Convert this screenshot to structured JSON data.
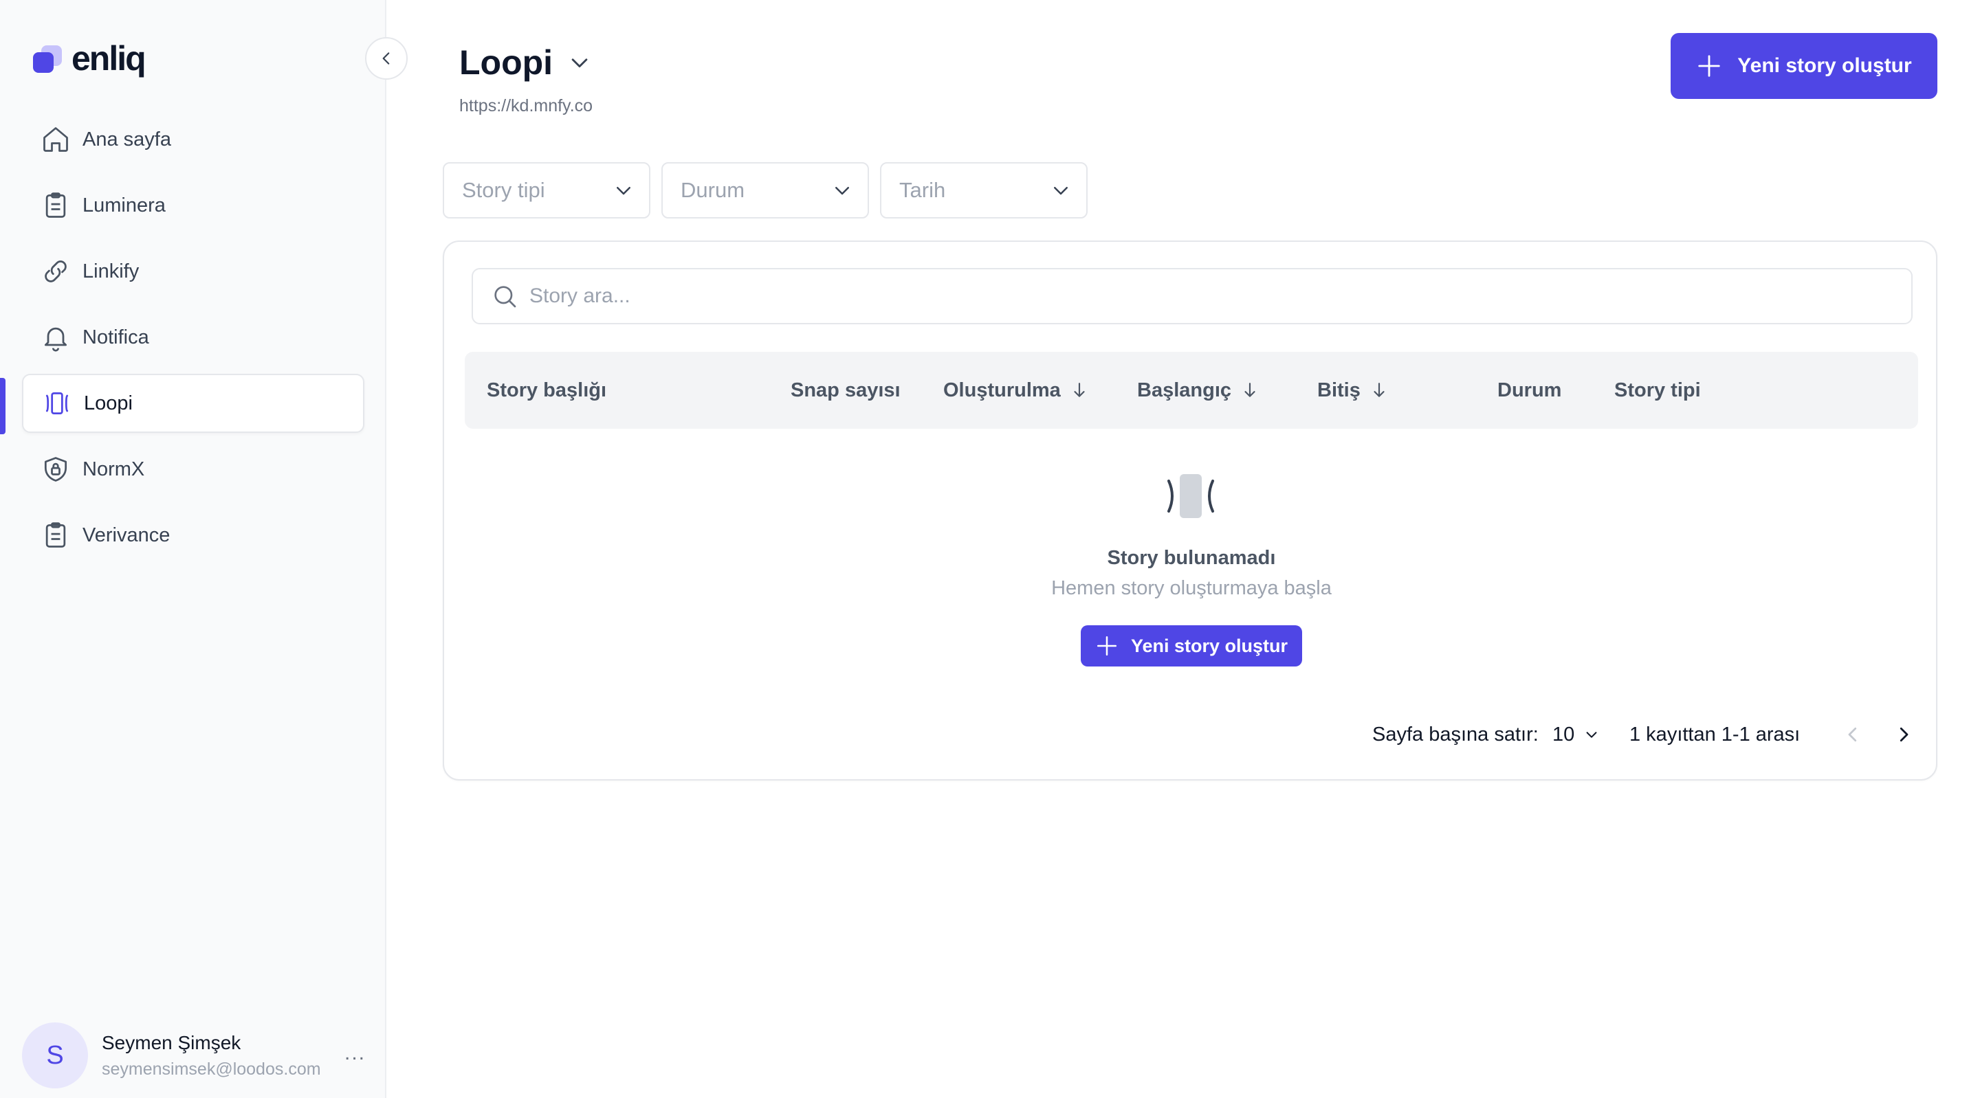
{
  "app": {
    "logo_text": "enliq"
  },
  "sidebar": {
    "items": [
      {
        "label": "Ana sayfa",
        "icon": "home-icon"
      },
      {
        "label": "Luminera",
        "icon": "clipboard-icon"
      },
      {
        "label": "Linkify",
        "icon": "link-icon"
      },
      {
        "label": "Notifica",
        "icon": "bell-icon"
      },
      {
        "label": "Loopi",
        "icon": "stories-icon",
        "active": true
      },
      {
        "label": "NormX",
        "icon": "shield-lock-icon"
      },
      {
        "label": "Verivance",
        "icon": "clipboard-icon"
      }
    ],
    "user": {
      "initial": "S",
      "name": "Seymen Şimşek",
      "email": "seymensimsek@loodos.com",
      "more": "..."
    }
  },
  "header": {
    "title": "Loopi",
    "url": "https://kd.mnfy.co",
    "primary_button": "Yeni story oluştur"
  },
  "filters": [
    {
      "placeholder": "Story tipi"
    },
    {
      "placeholder": "Durum"
    },
    {
      "placeholder": "Tarih"
    }
  ],
  "search": {
    "placeholder": "Story ara..."
  },
  "table": {
    "columns": [
      {
        "label": "Story başlığı",
        "sortable": false
      },
      {
        "label": "Snap sayısı",
        "sortable": false
      },
      {
        "label": "Oluşturulma",
        "sortable": true
      },
      {
        "label": "Başlangıç",
        "sortable": true
      },
      {
        "label": "Bitiş",
        "sortable": true
      },
      {
        "label": "Durum",
        "sortable": false
      },
      {
        "label": "Story tipi",
        "sortable": false
      }
    ]
  },
  "empty_state": {
    "title": "Story bulunamadı",
    "subtitle": "Hemen story oluşturmaya başla",
    "button": "Yeni story oluştur"
  },
  "pagination": {
    "rows_label": "Sayfa başına satır:",
    "rows_value": "10",
    "range_text": "1 kayıttan 1-1 arası"
  },
  "colors": {
    "accent": "#4f46e5",
    "sidebar_bg": "#f9fafb",
    "border": "#e5e7eb"
  }
}
